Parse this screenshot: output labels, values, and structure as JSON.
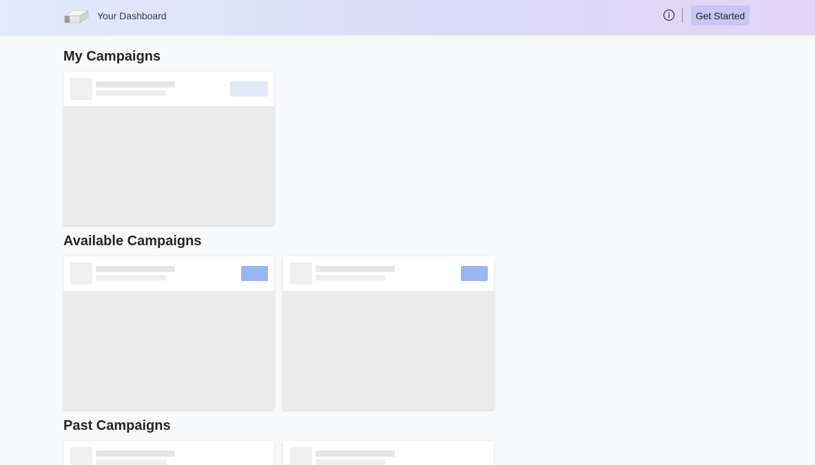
{
  "header": {
    "title": "Your Dashboard",
    "info_icon": "info-circle-icon",
    "cta_label": "Get Started",
    "logo_icon": "eraser-logo-icon"
  },
  "sections": {
    "my": {
      "title": "My Campaigns",
      "card_count": 1
    },
    "available": {
      "title": "Available Campaigns",
      "card_count": 2
    },
    "past": {
      "title": "Past Campaigns",
      "card_count": 2
    }
  },
  "colors": {
    "header_gradient": [
      "#e2e9fb",
      "#dcdaf9",
      "#e2d6f8"
    ],
    "cta_background": "#c9c6f5",
    "skeleton_button_blue": "#98b5f5",
    "skeleton_button_light": "#e3e8f7",
    "page_background": "#f8f9fb"
  }
}
